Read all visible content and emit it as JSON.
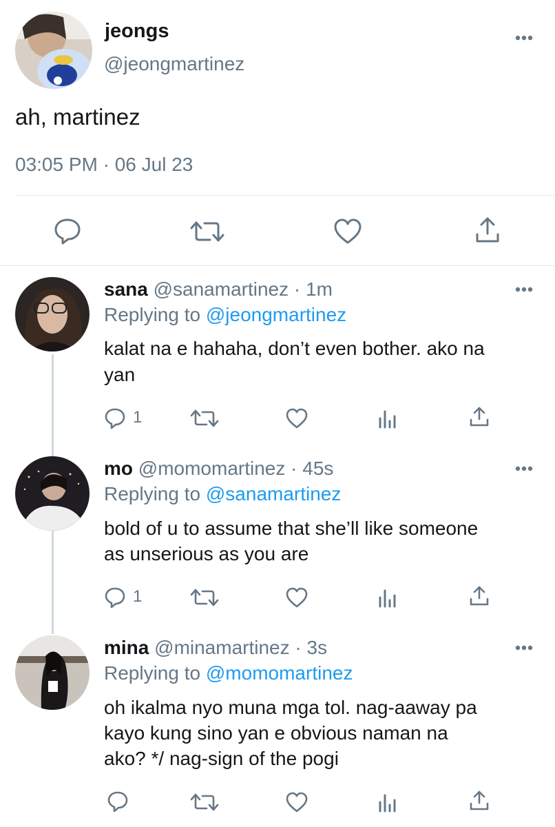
{
  "main_tweet": {
    "display_name": "jeongs",
    "handle": "@jeongmartinez",
    "text": "ah, martinez",
    "timestamp": "03:05 PM · 06 Jul 23",
    "actions": [
      "reply-icon",
      "retweet-icon",
      "like-icon",
      "share-icon"
    ]
  },
  "replies": [
    {
      "display_name": "sana",
      "handle": "@sanamartinez",
      "time": "· 1m",
      "replying_label": "Replying to",
      "replying_to": "@jeongmartinez",
      "text_line1": "kalat na e hahaha, don’t even bother. ako na",
      "text_line2": "yan",
      "reply_count": "1"
    },
    {
      "display_name": "mo",
      "handle": "@momomartinez",
      "time": "· 45s",
      "replying_label": "Replying to",
      "replying_to": "@sanamartinez",
      "text_line1": "bold of u to assume that she’ll like someone",
      "text_line2": "as unserious as you are",
      "reply_count": "1"
    },
    {
      "display_name": "mina",
      "handle": "@minamartinez",
      "time": "· 3s",
      "replying_label": "Replying to",
      "replying_to": "@momomartinez",
      "text_line1": "oh ikalma nyo muna mga tol. nag-aaway pa",
      "text_line2": "kayo kung sino yan e obvious naman na",
      "text_line3": "ako? */ nag-sign of the pogi",
      "reply_count": ""
    }
  ],
  "colors": {
    "text": "#14171a",
    "muted": "#657786",
    "link": "#1d9bf0",
    "divider": "#e1e8ed",
    "thread_line": "#cfd9de"
  }
}
